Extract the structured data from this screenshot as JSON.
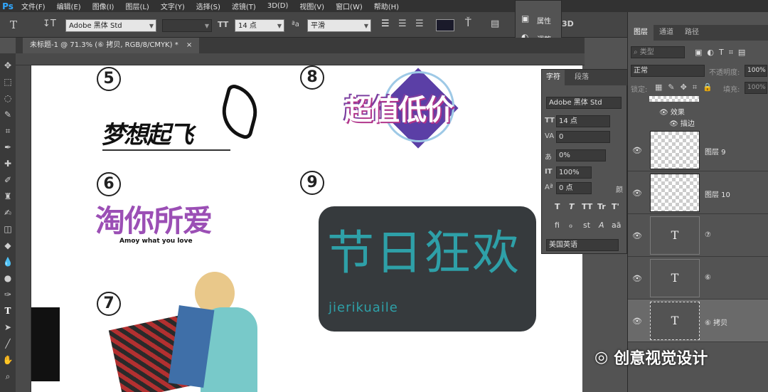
{
  "menu": {
    "logo": "Ps",
    "items": [
      "文件(F)",
      "编辑(E)",
      "图像(I)",
      "图层(L)",
      "文字(Y)",
      "选择(S)",
      "滤镜(T)",
      "3D(D)",
      "视图(V)",
      "窗口(W)",
      "帮助(H)"
    ]
  },
  "options": {
    "font_family": "Adobe 黑体 Std",
    "font_size": "14 点",
    "aa_label": "ªa",
    "antialias": "平滑",
    "threed": "3D"
  },
  "document": {
    "tab_title": "未标题-1 @ 71.3% (⑥ 拷贝, RGB/8/CMYK) *"
  },
  "props_mini": {
    "properties": "属性",
    "adjust": "调整"
  },
  "canvas": {
    "n5": "5",
    "n6": "6",
    "n7": "7",
    "n8": "8",
    "n9": "9",
    "dream": "梦想起飞",
    "taobao": "淘你所爱",
    "taobao_sub": "Amoy what you love",
    "chaozhi": "超值低价",
    "jieri": "节日狂欢",
    "jieri_sub": "jierikuaile"
  },
  "character": {
    "tab_char": "字符",
    "tab_para": "段落",
    "font": "Adobe 黑体 Std",
    "size": "14 点",
    "tracking": "0",
    "scale": "0%",
    "vscale": "100%",
    "baseline": "0 点",
    "color_label": "颜",
    "lang": "美国英语",
    "styles": [
      "T",
      "T",
      "TT",
      "Tr",
      "T'"
    ],
    "ot": [
      "fi",
      "ℴ",
      "st",
      "A",
      "aā"
    ]
  },
  "layers": {
    "tabs": [
      "图层",
      "通道",
      "路径"
    ],
    "kind": "类型",
    "blend": "正常",
    "opacity_label": "不透明度:",
    "opacity": "100%",
    "lock_label": "锁定:",
    "fill_label": "填充:",
    "fill": "100%",
    "effects": "效果",
    "stroke": "描边",
    "rows": [
      {
        "name": "图层 9",
        "kind": "raster"
      },
      {
        "name": "图层 10",
        "kind": "raster"
      },
      {
        "name": "⑦",
        "kind": "text"
      },
      {
        "name": "⑥",
        "kind": "text"
      },
      {
        "name": "⑥ 拷贝",
        "kind": "text"
      }
    ],
    "text_thumb": "T"
  },
  "watermark": "创意视觉设计",
  "colors": {
    "accent": "#31a8ff",
    "purple": "#7b3fa0",
    "teal": "#2ea0a8"
  }
}
